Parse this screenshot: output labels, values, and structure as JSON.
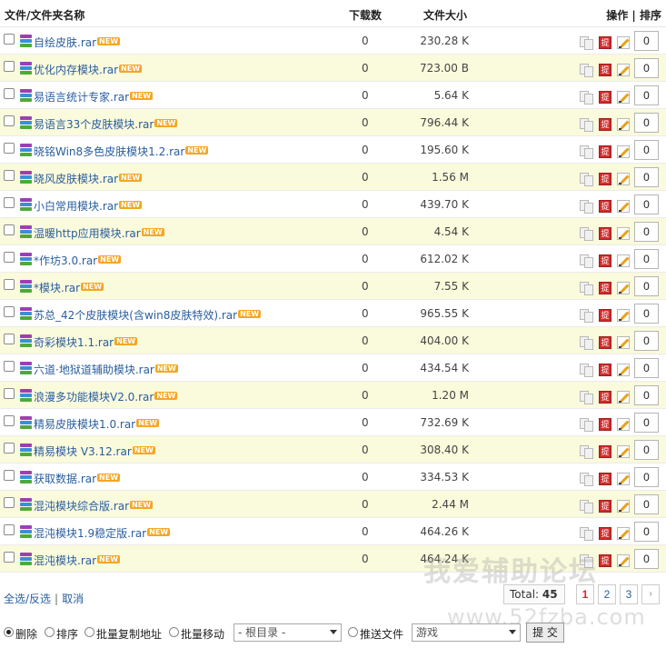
{
  "header": {
    "name_col": "文件/文件夹名称",
    "downloads_col": "下载数",
    "size_col": "文件大小",
    "ops_col": "操作 | 排序"
  },
  "files": [
    {
      "name": "自绘皮肤.rar",
      "downloads": "0",
      "size": "230.28 K",
      "sort": "0"
    },
    {
      "name": "优化内存模块.rar",
      "downloads": "0",
      "size": "723.00 B",
      "sort": "0"
    },
    {
      "name": "易语言统计专家.rar",
      "downloads": "0",
      "size": "5.64 K",
      "sort": "0"
    },
    {
      "name": "易语言33个皮肤模块.rar",
      "downloads": "0",
      "size": "796.44 K",
      "sort": "0"
    },
    {
      "name": "晓铭Win8多色皮肤模块1.2.rar",
      "downloads": "0",
      "size": "195.60 K",
      "sort": "0"
    },
    {
      "name": "晓风皮肤模块.rar",
      "downloads": "0",
      "size": "1.56 M",
      "sort": "0"
    },
    {
      "name": "小白常用模块.rar",
      "downloads": "0",
      "size": "439.70 K",
      "sort": "0"
    },
    {
      "name": "温暖http应用模块.rar",
      "downloads": "0",
      "size": "4.54 K",
      "sort": "0"
    },
    {
      "name": "*作坊3.0.rar",
      "downloads": "0",
      "size": "612.02 K",
      "sort": "0"
    },
    {
      "name": "*模块.rar",
      "downloads": "0",
      "size": "7.55 K",
      "sort": "0"
    },
    {
      "name": "苏总_42个皮肤模块(含win8皮肤特效).rar",
      "downloads": "0",
      "size": "965.55 K",
      "sort": "0"
    },
    {
      "name": "奇彩模块1.1.rar",
      "downloads": "0",
      "size": "404.00 K",
      "sort": "0"
    },
    {
      "name": "六道·地狱道辅助模块.rar",
      "downloads": "0",
      "size": "434.54 K",
      "sort": "0"
    },
    {
      "name": "浪漫多功能模块V2.0.rar",
      "downloads": "0",
      "size": "1.20 M",
      "sort": "0"
    },
    {
      "name": "精易皮肤模块1.0.rar",
      "downloads": "0",
      "size": "732.69 K",
      "sort": "0"
    },
    {
      "name": "精易模块 V3.12.rar",
      "downloads": "0",
      "size": "308.40 K",
      "sort": "0"
    },
    {
      "name": "获取数据.rar",
      "downloads": "0",
      "size": "334.53 K",
      "sort": "0"
    },
    {
      "name": "混沌模块综合版.rar",
      "downloads": "0",
      "size": "2.44 M",
      "sort": "0"
    },
    {
      "name": "混沌模块1.9稳定版.rar",
      "downloads": "0",
      "size": "464.26 K",
      "sort": "0"
    },
    {
      "name": "混沌模块.rar",
      "downloads": "0",
      "size": "464.24 K",
      "sort": "0"
    }
  ],
  "new_badge": "NEW",
  "ti_label": "提",
  "selection": {
    "select_all": "全选/反选",
    "separator": "|",
    "cancel": "取消"
  },
  "pager": {
    "total_label": "Total:",
    "total_value": "45",
    "pages": [
      "1",
      "2",
      "3"
    ],
    "next": "›"
  },
  "actions": {
    "delete": "删除",
    "sort": "排序",
    "batch_copy": "批量复制地址",
    "batch_move": "批量移动",
    "root_dir": "- 根目录 -",
    "push_file": "推送文件",
    "category": "游戏",
    "submit": "提 交"
  },
  "watermark": {
    "line1": "我爱辅助论坛",
    "line2": "www.52fzba.com"
  }
}
